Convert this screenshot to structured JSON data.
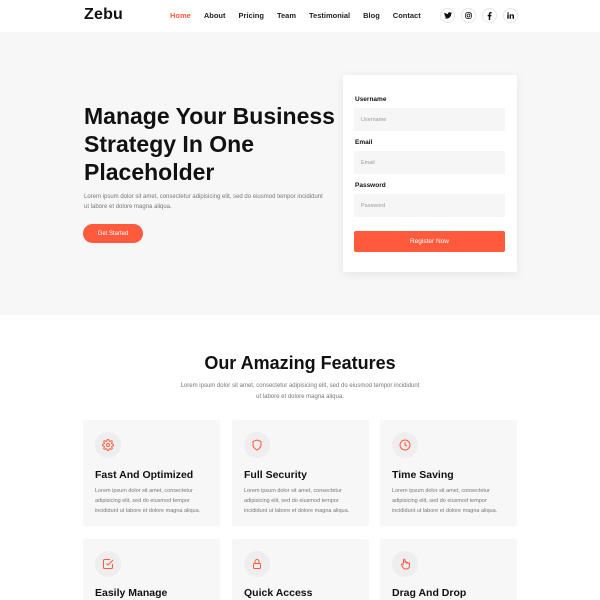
{
  "header": {
    "logo": "Zebu",
    "nav": [
      {
        "label": "Home",
        "active": true
      },
      {
        "label": "About",
        "active": false
      },
      {
        "label": "Pricing",
        "active": false
      },
      {
        "label": "Team",
        "active": false
      },
      {
        "label": "Testimonial",
        "active": false
      },
      {
        "label": "Blog",
        "active": false
      },
      {
        "label": "Contact",
        "active": false
      }
    ],
    "socials": [
      {
        "icon": "twitter-icon",
        "glyph": "t"
      },
      {
        "icon": "instagram-icon",
        "glyph": "◎"
      },
      {
        "icon": "facebook-icon",
        "glyph": "f"
      },
      {
        "icon": "linkedin-icon",
        "glyph": "in"
      }
    ]
  },
  "hero": {
    "title": "Manage Your Business Strategy In One Placeholder",
    "text": "Lorem ipsum dolor sit amet, consectetur adipisicing elit, sed do eiusmod tempor incididunt ut labore et dolore magna aliqua.",
    "cta_label": "Get Started"
  },
  "form": {
    "username_label": "Username",
    "username_placeholder": "Username",
    "email_label": "Email",
    "email_placeholder": "Email",
    "password_label": "Password",
    "password_placeholder": "Password",
    "submit_label": "Register Now"
  },
  "features": {
    "title": "Our Amazing Features",
    "text": "Lorem ipsum dolor sit amet, consectetur adipisicing elit, sed do eiusmod tempor incididunt ut labore et dolore magna aliqua.",
    "cards": [
      {
        "icon": "gear-icon",
        "title": "Fast And Optimized",
        "text": "Lorem ipsum dolor sit amet, consectetur adipisicing elit, sed do eiusmod tempor incididunt ut labore et dolore magna aliqua."
      },
      {
        "icon": "shield-icon",
        "title": "Full Security",
        "text": "Lorem ipsum dolor sit amet, consectetur adipisicing elit, sed do eiusmod tempor incididunt ut labore et dolore magna aliqua."
      },
      {
        "icon": "clock-icon",
        "title": "Time Saving",
        "text": "Lorem ipsum dolor sit amet, consectetur adipisicing elit, sed do eiusmod tempor incididunt ut labore et dolore magna aliqua."
      },
      {
        "icon": "checkbox-icon",
        "title": "Easily Manage",
        "text": ""
      },
      {
        "icon": "lock-icon",
        "title": "Quick Access",
        "text": ""
      },
      {
        "icon": "pointer-icon",
        "title": "Drag And Drop",
        "text": ""
      }
    ]
  },
  "colors": {
    "accent": "#ff5a3d",
    "hero_bg": "#f7f7f7",
    "card_bg": "#f7f7f7"
  }
}
